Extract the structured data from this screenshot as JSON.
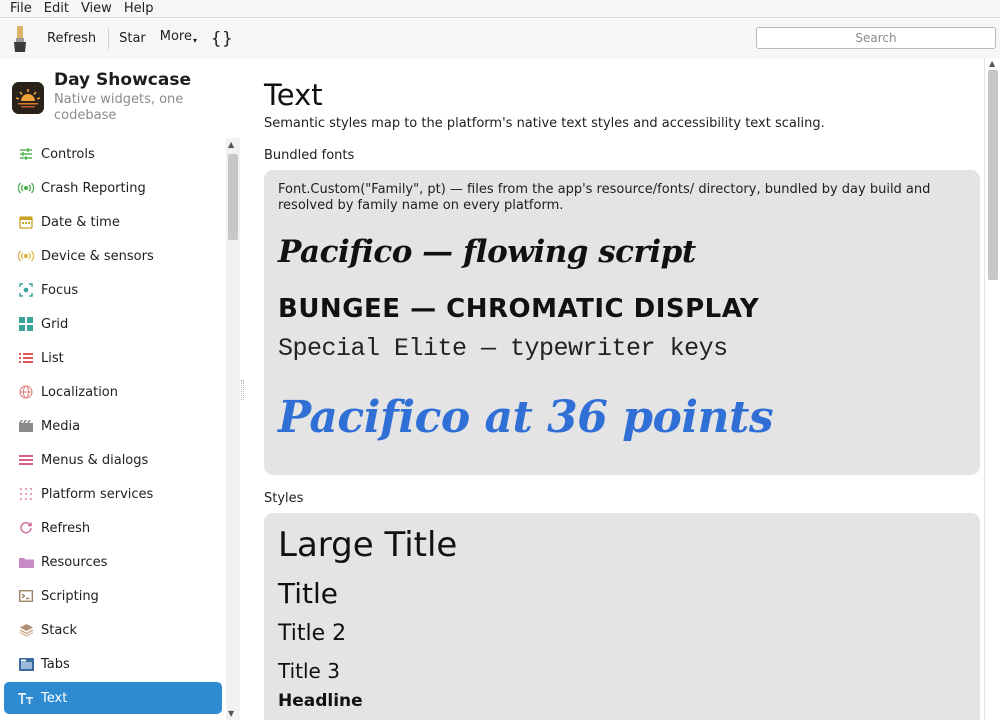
{
  "menubar": {
    "items": [
      "File",
      "Edit",
      "View",
      "Help"
    ]
  },
  "toolbar": {
    "refresh_label": "Refresh",
    "star_label": "Star",
    "more_label": "More",
    "braces_label": "{}",
    "search_placeholder": "Search"
  },
  "app": {
    "title": "Day Showcase",
    "subtitle": "Native widgets, one codebase"
  },
  "sidebar": {
    "items": [
      {
        "label": "Controls",
        "icon": "sliders-icon",
        "color": "#4caf50"
      },
      {
        "label": "Crash Reporting",
        "icon": "broadcast-icon",
        "color": "#4caf50"
      },
      {
        "label": "Date & time",
        "icon": "calendar-icon",
        "color": "#c9a227"
      },
      {
        "label": "Device & sensors",
        "icon": "sensor-icon",
        "color": "#e0b84a"
      },
      {
        "label": "Focus",
        "icon": "focus-icon",
        "color": "#3aa39a"
      },
      {
        "label": "Grid",
        "icon": "grid-icon",
        "color": "#3aa39a"
      },
      {
        "label": "List",
        "icon": "list-icon",
        "color": "#e05555"
      },
      {
        "label": "Localization",
        "icon": "globe-icon",
        "color": "#e88a8a"
      },
      {
        "label": "Media",
        "icon": "film-icon",
        "color": "#8a8a8a"
      },
      {
        "label": "Menus & dialogs",
        "icon": "menu-icon",
        "color": "#d9608a"
      },
      {
        "label": "Platform services",
        "icon": "dots-grid-icon",
        "color": "#e6a0c0"
      },
      {
        "label": "Refresh",
        "icon": "refresh-icon",
        "color": "#d06a9a"
      },
      {
        "label": "Resources",
        "icon": "folder-icon",
        "color": "#c78ac4"
      },
      {
        "label": "Scripting",
        "icon": "terminal-icon",
        "color": "#9a7a5a"
      },
      {
        "label": "Stack",
        "icon": "stack-icon",
        "color": "#b09070"
      },
      {
        "label": "Tabs",
        "icon": "tabs-icon",
        "color": "#3a6aa0"
      },
      {
        "label": "Text",
        "icon": "text-icon",
        "color": "#ffffff",
        "active": true
      }
    ]
  },
  "main": {
    "title": "Text",
    "description": "Semantic styles map to the platform's native text styles and accessibility text scaling.",
    "bundled": {
      "label": "Bundled fonts",
      "description": "Font.Custom(\"Family\", pt) — files from the app's resource/fonts/ directory, bundled by day build and resolved by family name on every platform.",
      "samples": {
        "pacifico": "Pacifico — flowing script",
        "bungee": "BUNGEE — CHROMATIC DISPLAY",
        "elite": "Special Elite — typewriter keys",
        "pacifico36": "Pacifico at 36 points"
      },
      "accent_color": "#2f6fd6"
    },
    "styles": {
      "label": "Styles",
      "rows": {
        "large_title": "Large Title",
        "title": "Title",
        "title2": "Title 2",
        "title3": "Title 3",
        "headline": "Headline"
      }
    }
  }
}
